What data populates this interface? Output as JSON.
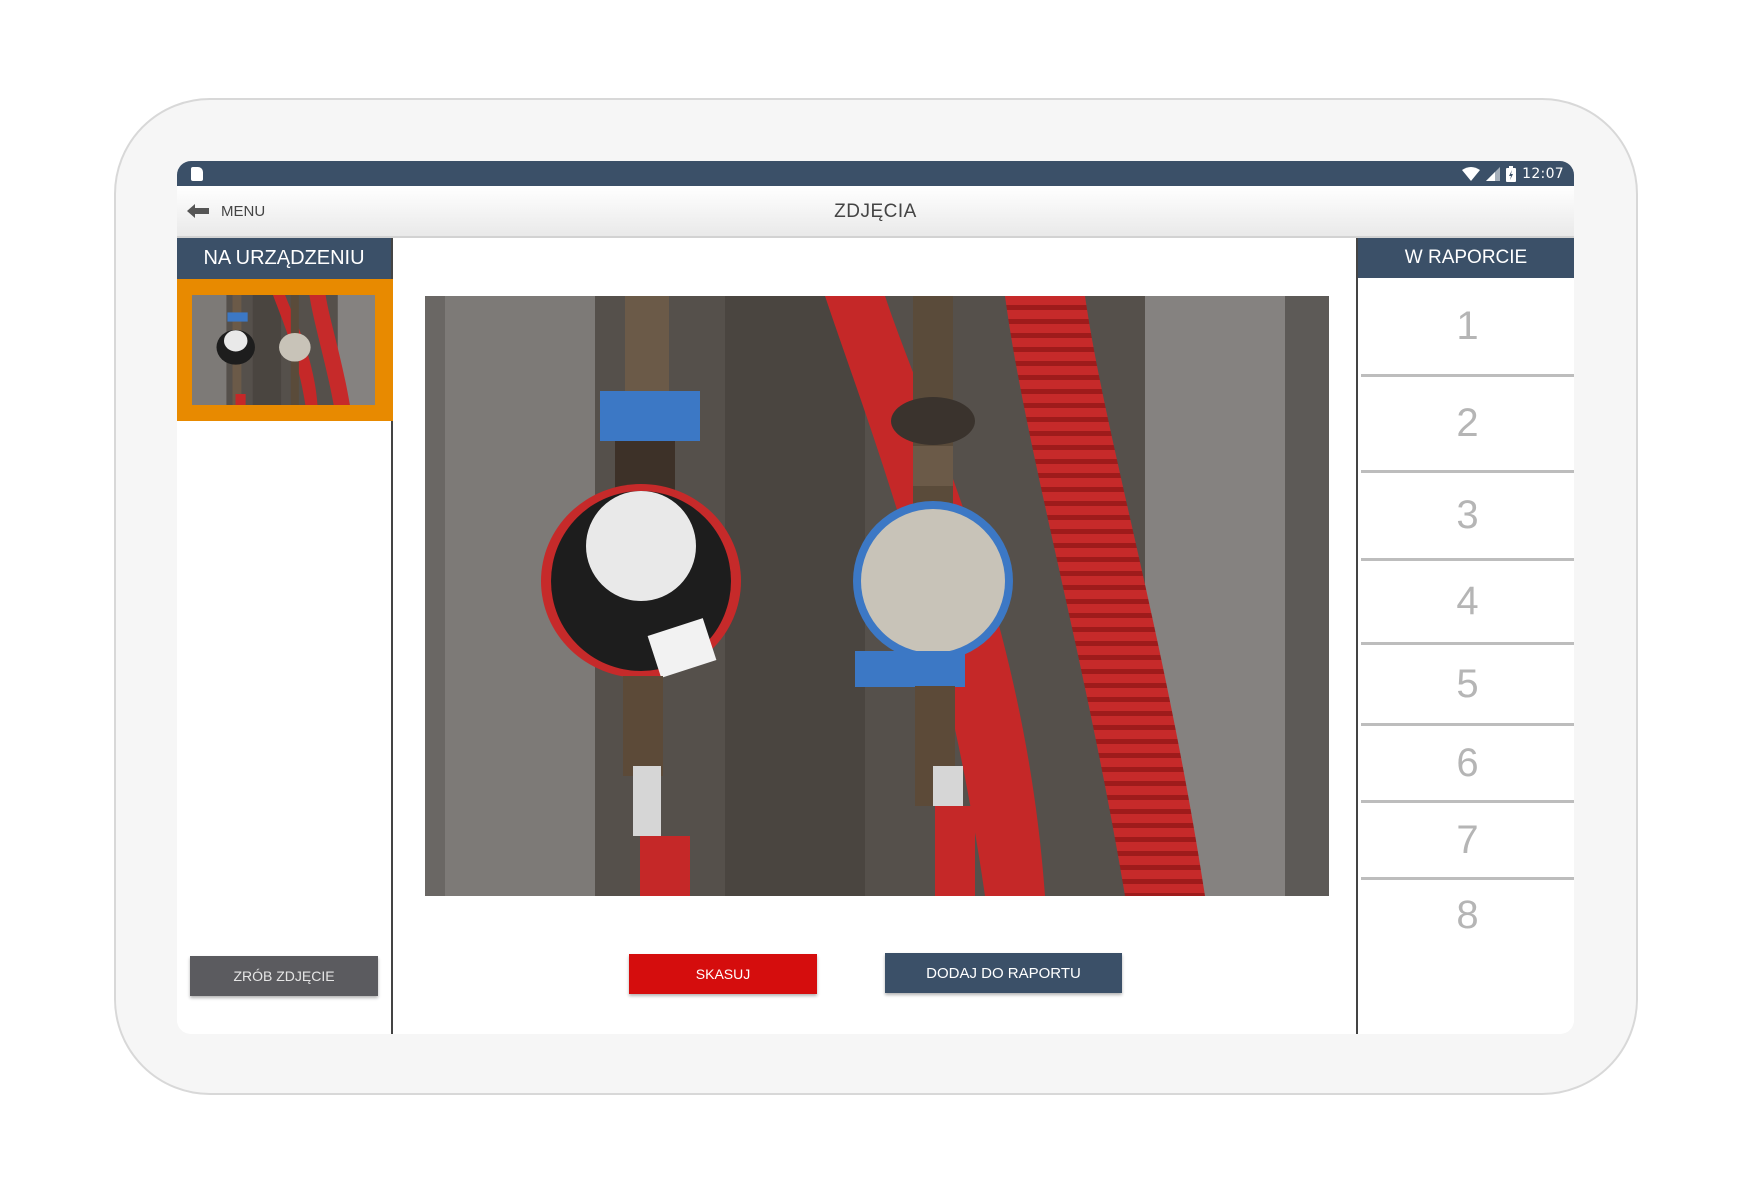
{
  "statusbar": {
    "time": "12:07"
  },
  "appbar": {
    "back_label": "MENU",
    "title": "ZDJĘCIA"
  },
  "left_panel": {
    "header": "NA URZĄDZENIU",
    "take_photo_label": "ZRÓB ZDJĘCIE"
  },
  "center": {
    "delete_label": "SKASUJ",
    "add_label": "DODAJ DO RAPORTU"
  },
  "right_panel": {
    "header": "W RAPORCIE",
    "slots": [
      "1",
      "2",
      "3",
      "4",
      "5",
      "6",
      "7",
      "8"
    ]
  },
  "colors": {
    "primary": "#3b5068",
    "accent_orange": "#e88a00",
    "danger": "#d50d0d",
    "neutral_button": "#5b5b5f"
  },
  "icons": {
    "back": "arrow-left-icon",
    "sd_card": "sd-card-icon",
    "wifi": "wifi-icon",
    "signal": "signal-icon",
    "battery": "battery-icon"
  }
}
